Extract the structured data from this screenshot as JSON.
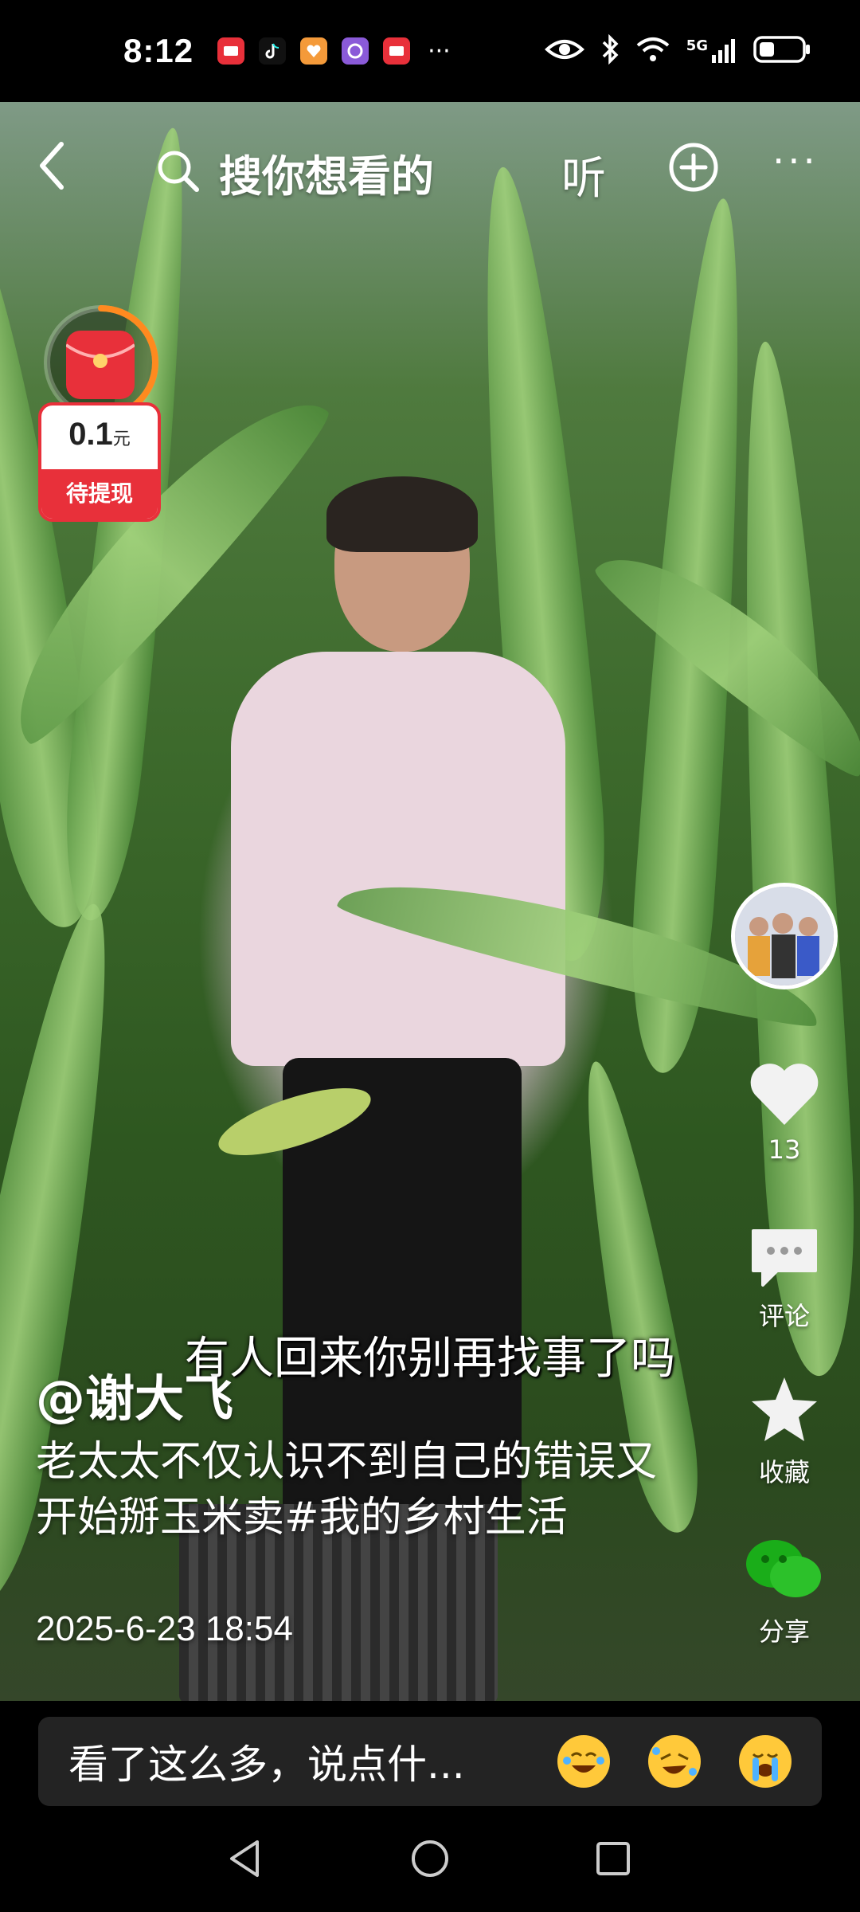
{
  "status_bar": {
    "time": "8:12",
    "network": "5G",
    "more_glyph": "···"
  },
  "top_bar": {
    "search_placeholder": "搜你想看的",
    "listen_label": "听",
    "more_glyph": "···"
  },
  "red_packet": {
    "amount": "0.1",
    "unit": "元",
    "label": "待提现",
    "progress": 0.4
  },
  "video": {
    "subtitle": "有人回来你别再找事了吗"
  },
  "post": {
    "author": "@谢大飞",
    "caption": "老太太不仅认识不到自己的错误又开始掰玉米卖#我的乡村生活",
    "date": "2025-6-23 18:54"
  },
  "actions": {
    "like_count": "13",
    "comment_label": "评论",
    "favorite_label": "收藏",
    "share_label": "分享"
  },
  "comment_bar": {
    "placeholder": "看了这么多，说点什..."
  },
  "colors": {
    "accent_red": "#e8303a",
    "wechat_green": "#1aad19"
  }
}
